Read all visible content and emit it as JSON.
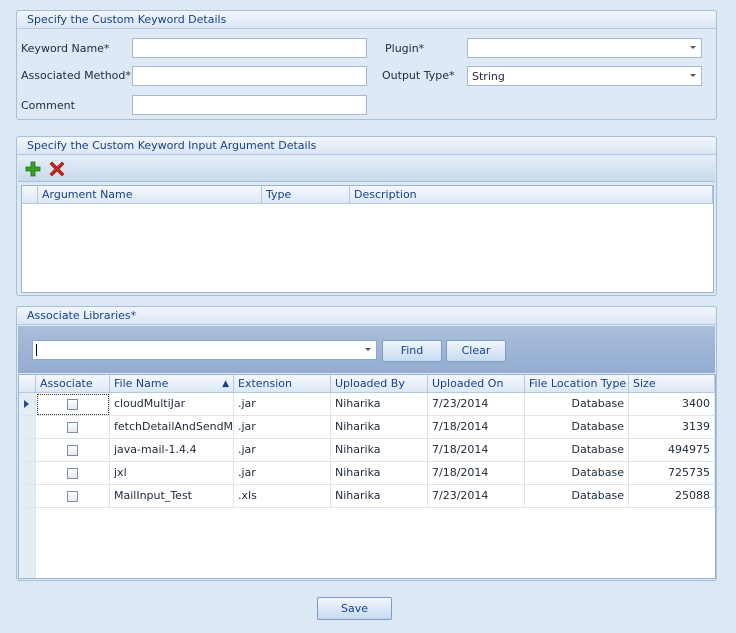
{
  "keyword_details": {
    "title": "Specify the Custom Keyword Details",
    "keyword_name_label": "Keyword Name*",
    "keyword_name_value": "",
    "associated_method_label": "Associated Method*",
    "associated_method_value": "",
    "comment_label": "Comment",
    "comment_value": "",
    "plugin_label": "Plugin*",
    "plugin_value": "",
    "output_type_label": "Output Type*",
    "output_type_value": "String"
  },
  "arguments": {
    "title": "Specify the Custom Keyword Input Argument Details",
    "add_icon": "plus-icon",
    "remove_icon": "delete-icon",
    "columns": [
      "Argument Name",
      "Type",
      "Description"
    ]
  },
  "libraries": {
    "title": "Associate Libraries*",
    "search_value": "",
    "find_label": "Find",
    "clear_label": "Clear",
    "columns": [
      "Associate",
      "File Name",
      "Extension",
      "Uploaded By",
      "Uploaded On",
      "File Location Type",
      "Size"
    ],
    "sort_indicator": "▲",
    "rows": [
      {
        "file_name": "cloudMultiJar",
        "extension": ".jar",
        "uploaded_by": "Niharika",
        "uploaded_on": "7/23/2014",
        "location": "Database",
        "size": "3400"
      },
      {
        "file_name": "fetchDetailAndSendMail",
        "extension": ".jar",
        "uploaded_by": "Niharika",
        "uploaded_on": "7/18/2014",
        "location": "Database",
        "size": "3139"
      },
      {
        "file_name": "java-mail-1.4.4",
        "extension": ".jar",
        "uploaded_by": "Niharika",
        "uploaded_on": "7/18/2014",
        "location": "Database",
        "size": "494975"
      },
      {
        "file_name": "jxl",
        "extension": ".jar",
        "uploaded_by": "Niharika",
        "uploaded_on": "7/18/2014",
        "location": "Database",
        "size": "725735"
      },
      {
        "file_name": "MailInput_Test",
        "extension": ".xls",
        "uploaded_by": "Niharika",
        "uploaded_on": "7/23/2014",
        "location": "Database",
        "size": "25088"
      }
    ]
  },
  "save_label": "Save",
  "colors": {
    "title_text": "#15428b",
    "panel_bg": "#dde8f5",
    "add_icon": "#3aa02a",
    "delete_icon": "#d0221b"
  }
}
